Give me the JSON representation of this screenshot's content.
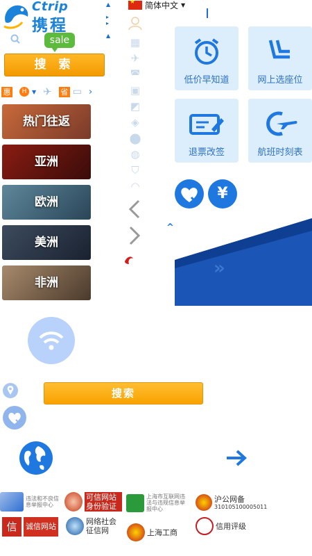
{
  "logo": {
    "latin": "Ctrip",
    "chinese": "携程"
  },
  "sale_badge": "sale",
  "search": {
    "top_label": "搜 索",
    "bottom_label": "搜索"
  },
  "language": {
    "label": "简体中文"
  },
  "quick_tags": [
    "惠",
    "H",
    "省"
  ],
  "destinations": [
    {
      "label": "热门往返",
      "bg": "#a0553a"
    },
    {
      "label": "亚洲",
      "bg": "#6e1a12"
    },
    {
      "label": "欧洲",
      "bg": "#3e6174"
    },
    {
      "label": "美洲",
      "bg": "#2d3a4d"
    },
    {
      "label": "非洲",
      "bg": "#7a6652"
    }
  ],
  "feature_tiles": [
    {
      "label": "低价早知道",
      "icon": "alarm-clock-icon"
    },
    {
      "label": "网上选座位",
      "icon": "seat-icon"
    },
    {
      "label": "退票改签",
      "icon": "ticket-edit-icon"
    },
    {
      "label": "航班时刻表",
      "icon": "flight-schedule-icon"
    }
  ],
  "badges": {
    "yen": "¥"
  },
  "footer": {
    "items": [
      {
        "label": "违法和不良信息举报中心"
      },
      {
        "label": "可信网站身份验证"
      },
      {
        "label": "上海市互联网违法与违规信息举报中心"
      },
      {
        "label": "沪公网备",
        "code": "310105100005011"
      },
      {
        "label": "诚信网站"
      },
      {
        "label": "网络社会征信网"
      },
      {
        "label": "上海工商"
      },
      {
        "label": "信用评级"
      }
    ]
  },
  "colors": {
    "primary": "#1e78e0",
    "tile_bg": "#dcedfb",
    "orange": "#f9a200",
    "green": "#5cba3c"
  }
}
